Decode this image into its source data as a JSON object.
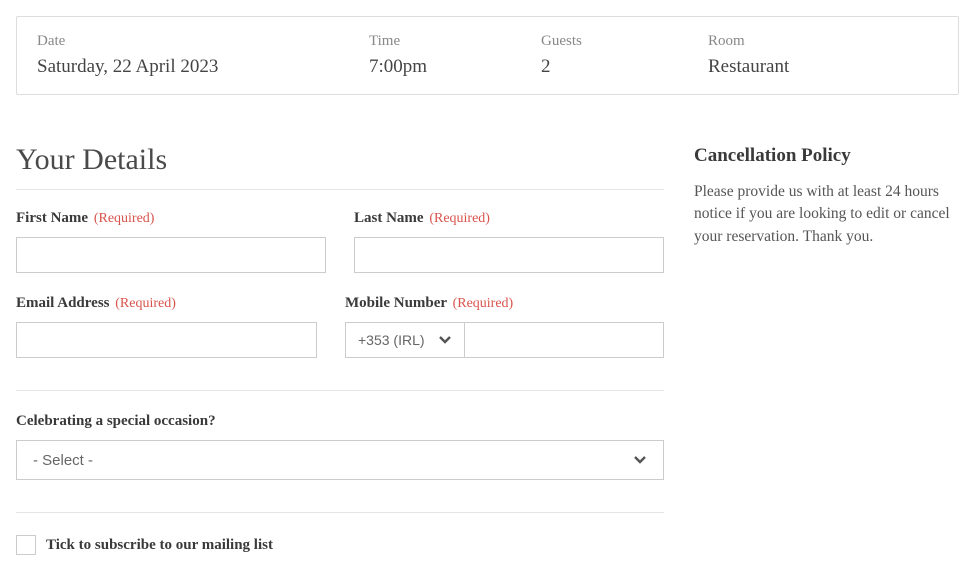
{
  "summary": {
    "date_label": "Date",
    "date_value": "Saturday, 22 April 2023",
    "time_label": "Time",
    "time_value": "7:00pm",
    "guests_label": "Guests",
    "guests_value": "2",
    "room_label": "Room",
    "room_value": "Restaurant"
  },
  "details": {
    "heading": "Your Details",
    "first_name_label": "First Name",
    "last_name_label": "Last Name",
    "email_label": "Email Address",
    "mobile_label": "Mobile Number",
    "required": "(Required)",
    "country_code": "+353 (IRL)",
    "occasion_label": "Celebrating a special occasion?",
    "occasion_placeholder": "- Select -",
    "subscribe_label": "Tick to subscribe to our mailing list"
  },
  "policy": {
    "title": "Cancellation Policy",
    "text": "Please provide us with at least 24 hours notice if you are looking to edit or cancel your reservation. Thank you."
  }
}
